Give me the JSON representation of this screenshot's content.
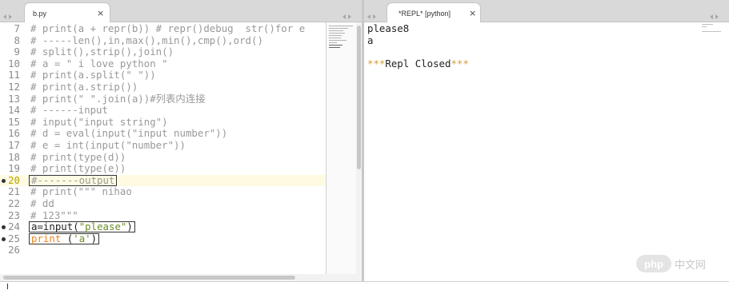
{
  "left_pane": {
    "tab": {
      "title": "b.py"
    },
    "lines": [
      {
        "n": "7",
        "text": "# print(a + repr(b)) # repr()debug  str()for e"
      },
      {
        "n": "8",
        "text": "# -----len(),in,max(),min(),cmp(),ord()"
      },
      {
        "n": "9",
        "text": "# split(),strip(),join()"
      },
      {
        "n": "10",
        "text": "# a = \" i love python \""
      },
      {
        "n": "11",
        "text": "# print(a.split(\" \"))"
      },
      {
        "n": "12",
        "text": "# print(a.strip())"
      },
      {
        "n": "13",
        "text": "# print(\" \".join(a))#列表内连接"
      },
      {
        "n": "14",
        "text": "# ------input"
      },
      {
        "n": "15",
        "text": "# input(\"input string\")"
      },
      {
        "n": "16",
        "text": "# d = eval(input(\"input number\"))"
      },
      {
        "n": "17",
        "text": "# e = int(input(\"number\"))"
      },
      {
        "n": "18",
        "text": "# print(type(d))"
      },
      {
        "n": "19",
        "text": "# print(type(e))"
      },
      {
        "n": "20",
        "text": "#-------output"
      },
      {
        "n": "21",
        "text": "# print(\"\"\" nihao"
      },
      {
        "n": "22",
        "text": "# dd"
      },
      {
        "n": "23",
        "text": "# 123\"\"\""
      },
      {
        "n": "24",
        "text": ""
      },
      {
        "n": "25",
        "text": ""
      },
      {
        "n": "26",
        "text": ""
      }
    ],
    "line24": {
      "pre": "a=input(",
      "str": "\"please\"",
      "post": ")"
    },
    "line25": {
      "kw": "print",
      "pre": " (",
      "str": "'a'",
      "post": ")"
    }
  },
  "right_pane": {
    "tab": {
      "title": "*REPL* [python]"
    },
    "output": [
      "please8",
      "a",
      ""
    ],
    "closed": {
      "stars_l": "***",
      "text": "Repl Closed",
      "stars_r": "***"
    }
  },
  "watermark": {
    "logo": "php",
    "site": "中文网"
  },
  "colors": {
    "comment": "#999999",
    "string": "#6b8e23",
    "keyword": "#e8861e",
    "active_line": "#fffbe3"
  }
}
